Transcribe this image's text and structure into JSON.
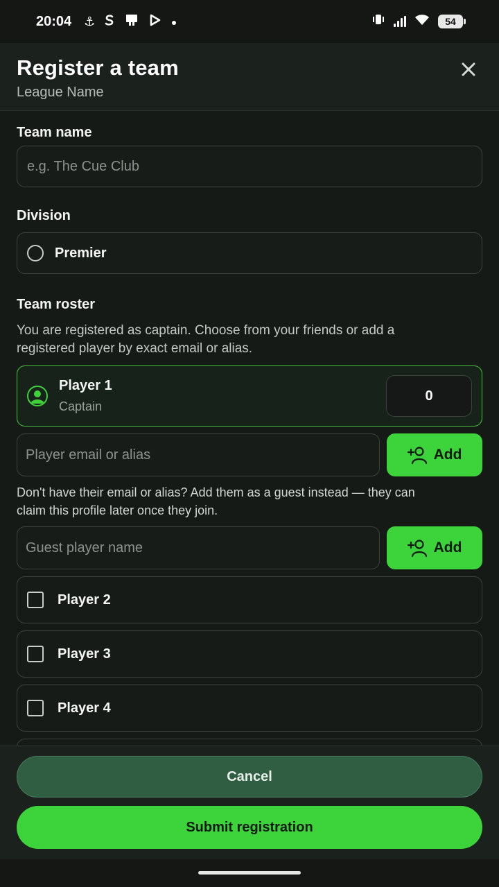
{
  "status_bar": {
    "time": "20:04",
    "notification_icons": [
      "anchor-icon",
      "s-icon",
      "cast-icon",
      "play-icon",
      "dot-icon"
    ],
    "battery": "54"
  },
  "header": {
    "title": "Register a team",
    "subtitle": "League Name"
  },
  "form": {
    "team_name": {
      "label": "Team name",
      "placeholder": "e.g. The Cue Club",
      "value": ""
    },
    "division": {
      "label": "Division",
      "options": [
        {
          "label": "Premier",
          "selected": false
        }
      ]
    },
    "roster": {
      "label": "Team roster",
      "description": "You are registered as captain. Choose from your friends or add a registered player by exact email or alias.",
      "captain": {
        "name": "Player 1",
        "role": "Captain",
        "value": "0"
      },
      "email_input": {
        "placeholder": "Player email or alias",
        "add_label": "Add"
      },
      "guest_help": "Don't have their email or alias? Add them as a guest instead — they can claim this profile later once they join.",
      "guest_input": {
        "placeholder": "Guest player name",
        "add_label": "Add"
      },
      "players": [
        {
          "name": "Player 2",
          "checked": false
        },
        {
          "name": "Player 3",
          "checked": false
        },
        {
          "name": "Player 4",
          "checked": false
        }
      ]
    }
  },
  "footer": {
    "cancel_label": "Cancel",
    "submit_label": "Submit registration"
  },
  "colors": {
    "accent": "#3dd33a",
    "background": "#161a17",
    "cancel_bg": "#2f5e43"
  }
}
